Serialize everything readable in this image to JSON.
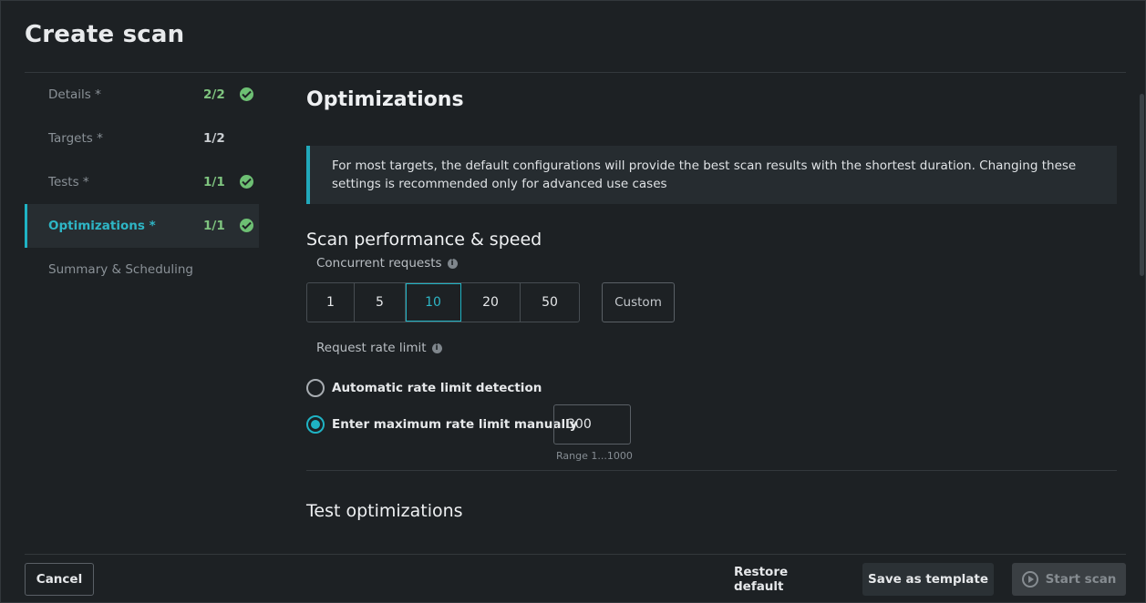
{
  "dialog": {
    "title": "Create scan"
  },
  "sidebar": {
    "items": [
      {
        "label": "Details *",
        "count": "2/2",
        "done": true
      },
      {
        "label": "Targets *",
        "count": "1/2",
        "done": false
      },
      {
        "label": "Tests *",
        "count": "1/1",
        "done": true
      },
      {
        "label": "Optimizations *",
        "count": "1/1",
        "done": true
      },
      {
        "label": "Summary & Scheduling",
        "count": "",
        "done": false
      }
    ],
    "active_index": 3
  },
  "main": {
    "heading": "Optimizations",
    "info_text": "For most targets, the default configurations will provide the best scan results with the shortest duration. Changing these settings is recommended only for advanced use cases",
    "performance": {
      "heading": "Scan performance & speed",
      "concurrent_label": "Concurrent requests",
      "concurrent_options": [
        "1",
        "5",
        "10",
        "20",
        "50"
      ],
      "concurrent_selected": "10",
      "custom_label": "Custom",
      "rate_label": "Request rate limit",
      "radio_auto": "Automatic rate limit detection",
      "radio_manual": "Enter maximum rate limit manually",
      "rate_value": "300",
      "rate_range": "Range 1...1000"
    },
    "test_heading": "Test optimizations"
  },
  "footer": {
    "cancel": "Cancel",
    "restore": "Restore default",
    "save_template": "Save as template",
    "start": "Start scan"
  },
  "colors": {
    "accent": "#1fb3c4",
    "success": "#6dbf73",
    "background": "#1d2124"
  },
  "icons": [
    "check-circle-icon",
    "info-icon",
    "play-circle-icon"
  ]
}
